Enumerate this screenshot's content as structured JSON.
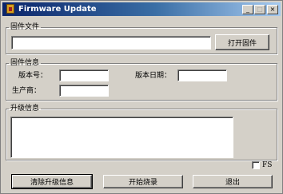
{
  "window": {
    "title": "Firmware Update",
    "controls": {
      "minimize": "_",
      "maximize": "□",
      "close": "×"
    }
  },
  "firmware_file": {
    "group_label": "固件文件",
    "path_value": "",
    "open_button": "打开固件"
  },
  "firmware_info": {
    "group_label": "固件信息",
    "version_label": "版本号：",
    "version_value": "",
    "date_label": "版本日期：",
    "date_value": "",
    "vendor_label": "生产商：",
    "vendor_value": ""
  },
  "upgrade_info": {
    "group_label": "升级信息",
    "log_text": ""
  },
  "fs_checkbox": {
    "label": "FS",
    "checked": false
  },
  "footer": {
    "clear_button": "清除升级信息",
    "start_button": "开始烧录",
    "exit_button": "退出"
  },
  "colors": {
    "window_face": "#d4d0c8",
    "title_bar_start": "#0a246a",
    "title_bar_end": "#a6caf0"
  }
}
